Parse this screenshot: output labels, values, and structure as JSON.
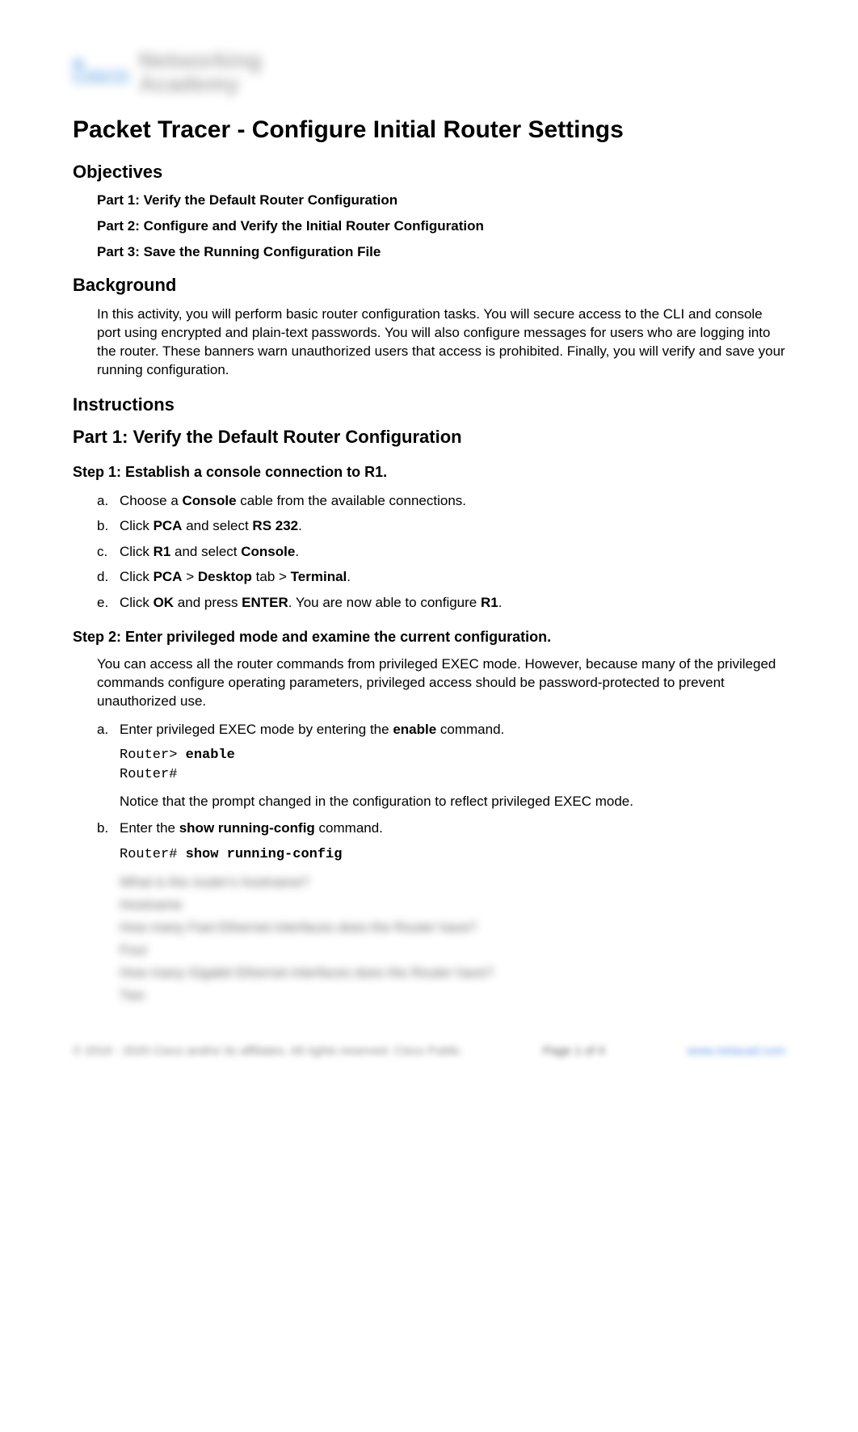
{
  "logo": {
    "brand_top": "ılıılı",
    "brand_bottom": "CISCO",
    "text_line1": "Networking",
    "text_line2": "Academy"
  },
  "title": "Packet Tracer - Configure Initial Router Settings",
  "sections": {
    "objectives": {
      "heading": "Objectives",
      "items": [
        "Part 1: Verify the Default Router Configuration",
        "Part 2: Configure and Verify the Initial Router Configuration",
        "Part 3: Save the Running Configuration File"
      ]
    },
    "background": {
      "heading": "Background",
      "text": "In this activity, you will perform basic router configuration tasks. You will secure access to the CLI and console port using encrypted and plain-text passwords. You will also configure messages for users who are logging into the router. These banners warn unauthorized users that access is prohibited. Finally, you will verify and save your running configuration."
    },
    "instructions": {
      "heading": "Instructions",
      "part1": {
        "heading": "Part 1: Verify the Default Router Configuration",
        "step1": {
          "heading": "Step 1: Establish a console connection to R1.",
          "items": {
            "a": {
              "pre": "Choose a ",
              "b1": "Console",
              "post": " cable from the available connections."
            },
            "b": {
              "pre": "Click ",
              "b1": "PCA",
              "mid": " and select ",
              "b2": "RS 232",
              "post": "."
            },
            "c": {
              "pre": "Click ",
              "b1": "R1",
              "mid": " and select ",
              "b2": "Console",
              "post": "."
            },
            "d": {
              "pre": "Click ",
              "b1": "PCA",
              "sep1": " > ",
              "b2": "Desktop",
              "mid": " tab > ",
              "b3": "Terminal",
              "post": "."
            },
            "e": {
              "pre": "Click ",
              "b1": "OK",
              "mid": " and press ",
              "b2": "ENTER",
              "mid2": ". You are now able to configure ",
              "b3": "R1",
              "post": "."
            }
          }
        },
        "step2": {
          "heading": "Step 2: Enter privileged mode and examine the current configuration.",
          "intro": "You can access all the router commands from privileged EXEC mode. However, because many of the privileged commands configure operating parameters, privileged access should be password-protected to prevent unauthorized use.",
          "a": {
            "pre": "Enter privileged EXEC mode by entering the ",
            "b1": "enable",
            "post": " command.",
            "code_prompt1": "Router> ",
            "code_cmd1": "enable",
            "code_prompt2": "Router#",
            "note": "Notice that the prompt changed in the configuration to reflect privileged EXEC mode."
          },
          "b": {
            "pre": "Enter the ",
            "b1": "show running-config",
            "post": " command.",
            "code_prompt": "Router# ",
            "code_cmd": "show running-config"
          }
        }
      }
    }
  },
  "blurred": {
    "q1": "What is the router's hostname?",
    "a1": "Hostname",
    "q2": "How many Fast Ethernet interfaces does the Router have?",
    "a2": "Four",
    "q3": "How many Gigabit Ethernet interfaces does the Router have?",
    "a3": "Two"
  },
  "footer": {
    "left": "© 2019 - 2020 Cisco and/or its affiliates. All rights reserved. Cisco Public",
    "center": "Page 1 of 4",
    "right": "www.netacad.com"
  }
}
